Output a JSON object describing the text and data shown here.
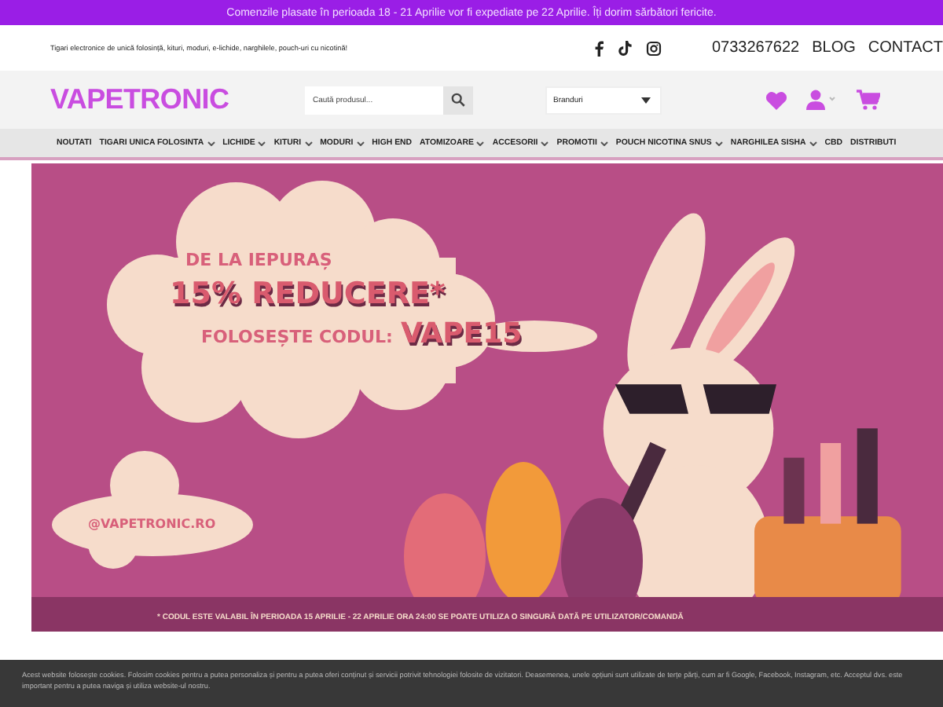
{
  "announcement": "Comenzile plasate în perioada 18 - 21 Aprilie vor fi expediate pe 22 Aprilie. Îți dorim sărbători fericite.",
  "tagline": "Tigari electronice de unică folosință, kituri, moduri, e-lichide, narghilele, pouch-uri cu nicotină!",
  "phone": "0733267622",
  "top_links": [
    "BLOG",
    "CONTACT"
  ],
  "logo": "VAPETRONIC",
  "search": {
    "placeholder": "Caută produsul..."
  },
  "brand_select": {
    "value": "Branduri"
  },
  "nav": [
    {
      "label": "NOUTATI",
      "dropdown": false
    },
    {
      "label": "TIGARI UNICA FOLOSINTA",
      "dropdown": true
    },
    {
      "label": "LICHIDE",
      "dropdown": true
    },
    {
      "label": "KITURI",
      "dropdown": true
    },
    {
      "label": "MODURI",
      "dropdown": true
    },
    {
      "label": "HIGH END",
      "dropdown": false
    },
    {
      "label": "ATOMIZOARE",
      "dropdown": true
    },
    {
      "label": "ACCESORII",
      "dropdown": true
    },
    {
      "label": "PROMOTII",
      "dropdown": true
    },
    {
      "label": "POUCH NICOTINA SNUS",
      "dropdown": true
    },
    {
      "label": "NARGHILEA SISHA",
      "dropdown": true
    },
    {
      "label": "CBD",
      "dropdown": false
    },
    {
      "label": "DISTRIBUTI",
      "dropdown": false
    }
  ],
  "banner": {
    "line_1": "DE LA IEPURAȘ",
    "line_2": "15% REDUCERE*",
    "line_3_prefix": "FOLOSEȘTE CODUL:",
    "code": "VAPE15",
    "handle": "@VAPETRONIC.RO",
    "footnote": "* CODUL ESTE VALABIL ÎN PERIOADA 15 APRILIE - 22 APRILIE ORA 24:00 SE POATE UTILIZA O SINGURĂ DATĂ PE UTILIZATOR/COMANDĂ"
  },
  "cookie_notice": "Acest website folosește cookies. Folosim cookies pentru a putea personaliza și pentru a putea oferi conținut și servicii potrivit tehnologiei folosite de vizitatori. Deasemenea, unele opțiuni sunt utilizate de terțe părți, cum ar fi Google, Facebook, Instagram, etc. Acceptul dvs. este important pentru a putea naviga și utiliza website-ul nostru."
}
